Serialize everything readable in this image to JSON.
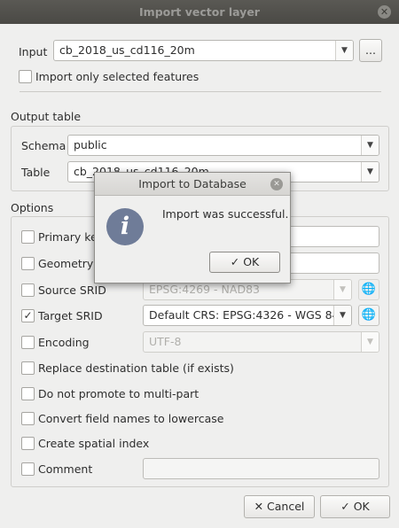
{
  "window": {
    "title": "Import vector layer",
    "close_icon": "close-icon"
  },
  "input": {
    "label": "Input",
    "value": "cb_2018_us_cd116_20m",
    "browse_label": "..."
  },
  "import_selected": {
    "label": "Import only selected features",
    "checked": false
  },
  "output_table": {
    "title": "Output table",
    "schema_label": "Schema",
    "schema_value": "public",
    "table_label": "Table",
    "table_value": "cb_2018_us_cd116_20m"
  },
  "options": {
    "title": "Options",
    "primary_key_label": "Primary key",
    "geometry_label": "Geometry column",
    "source_srid_label": "Source SRID",
    "source_srid_value": "EPSG:4269 - NAD83",
    "target_srid_label": "Target SRID",
    "target_srid_value": "Default CRS: EPSG:4326 - WGS 84",
    "target_srid_checked": true,
    "encoding_label": "Encoding",
    "encoding_value": "UTF-8",
    "replace_label": "Replace destination table (if exists)",
    "no_promote_label": "Do not promote to multi-part",
    "lowercase_label": "Convert field names to lowercase",
    "spatial_index_label": "Create spatial index",
    "comment_label": "Comment"
  },
  "buttons": {
    "cancel_label": "Cancel",
    "ok_label": "OK"
  },
  "modal": {
    "title": "Import to Database",
    "message": "Import was successful.",
    "ok_label": "OK",
    "icon": "info-icon"
  },
  "colors": {
    "titlebar": "#4f4e4a",
    "info_icon": "#6f7c98"
  }
}
